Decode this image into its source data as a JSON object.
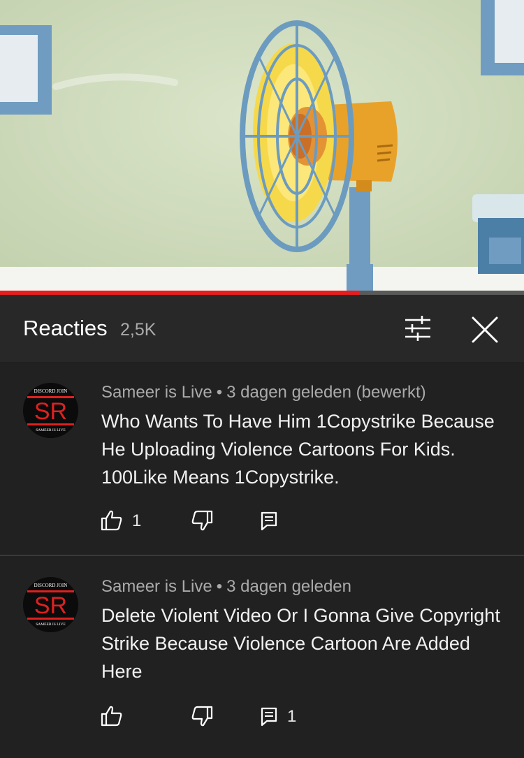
{
  "video": {
    "progress": 0.685
  },
  "header": {
    "title": "Reacties",
    "count": "2,5K"
  },
  "avatar": {
    "top_text": "DISCORD JOIN",
    "initials": "SR",
    "bottom_text": "SAMEER IS LIVE"
  },
  "comments": [
    {
      "author": "Sameer is Live",
      "separator": "•",
      "time": "3 dagen geleden (bewerkt)",
      "text": "Who Wants To Have Him 1Copystrike Because He Uploading Violence Cartoons For Kids. 100Like Means 1Copystrike.",
      "likes": "1",
      "replies": ""
    },
    {
      "author": "Sameer is Live",
      "separator": "•",
      "time": "3 dagen geleden",
      "text": "Delete Violent Video Or I Gonna Give Copyright Strike Because Violence Cartoon Are Added Here",
      "likes": "",
      "replies": "1"
    }
  ],
  "colors": {
    "accent": "#e61e1e",
    "panel": "#212121",
    "header": "#282828"
  },
  "icons": [
    "filter-icon",
    "close-icon",
    "thumbs-up-icon",
    "thumbs-down-icon",
    "reply-icon"
  ]
}
